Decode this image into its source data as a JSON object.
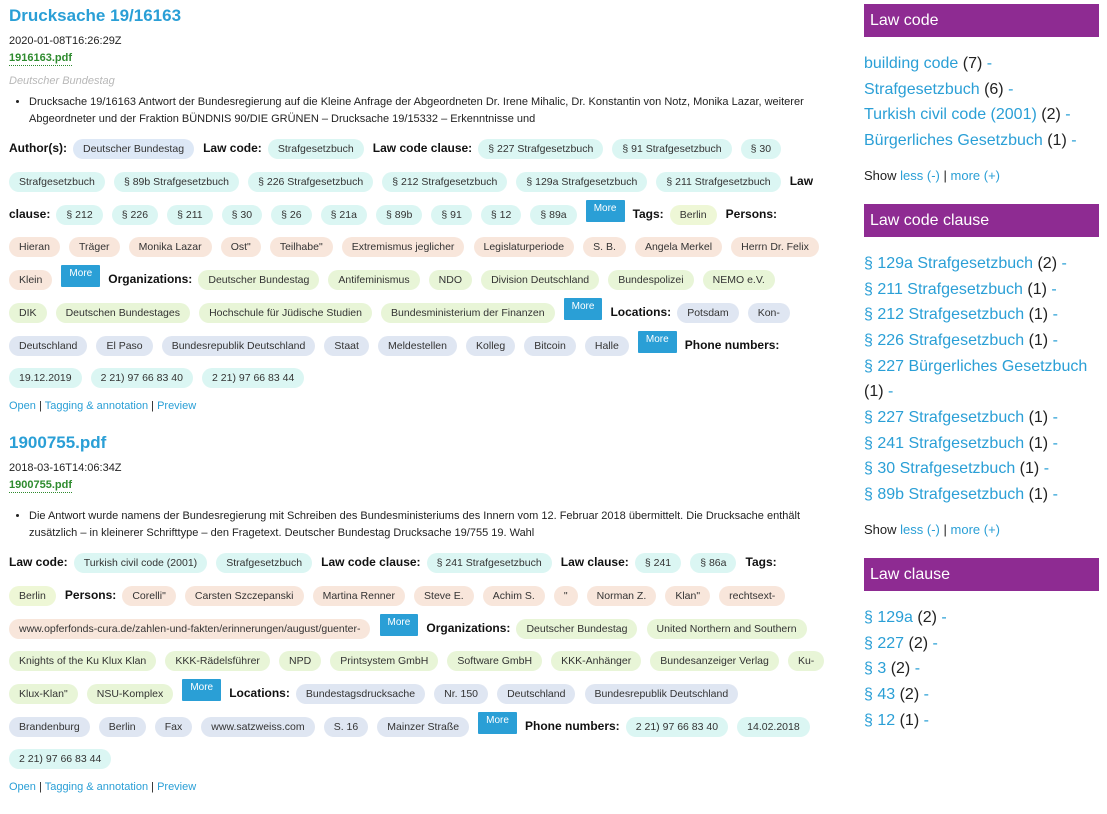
{
  "results": [
    {
      "title": "Drucksache 19/16163",
      "date": "2020-01-08T16:26:29Z",
      "file": "1916163.pdf",
      "source": "Deutscher Bundestag",
      "snippet": "Drucksache 19/16163 Antwort der Bundesregierung auf die Kleine Anfrage der Abgeordneten Dr. Irene Mihalic, Dr. Konstantin von Notz, Monika Lazar, weiterer Abgeordneter und der Fraktion BÜNDNIS 90/DIE GRÜNEN – Drucksache 19/15332 – Erkenntnisse und",
      "facets": [
        {
          "label": "Author(s):",
          "type": "author",
          "values": [
            "Deutscher Bundestag"
          ],
          "more": false
        },
        {
          "label": "Law code:",
          "type": "lc",
          "values": [
            "Strafgesetzbuch"
          ],
          "more": false
        },
        {
          "label": "Law code clause:",
          "type": "lcc",
          "values": [
            "§ 227 Strafgesetzbuch",
            "§ 91 Strafgesetzbuch",
            "§ 30 Strafgesetzbuch",
            "§ 89b Strafgesetzbuch",
            "§ 226 Strafgesetzbuch",
            "§ 212 Strafgesetzbuch",
            "§ 129a Strafgesetzbuch",
            "§ 211 Strafgesetzbuch"
          ],
          "more": false
        },
        {
          "label": "Law clause:",
          "type": "cl",
          "values": [
            "§ 212",
            "§ 226",
            "§ 211",
            "§ 30",
            "§ 26",
            "§ 21a",
            "§ 89b",
            "§ 91",
            "§ 12",
            "§ 89a"
          ],
          "more": true
        },
        {
          "label": "Tags:",
          "type": "tag",
          "values": [
            "Berlin"
          ],
          "more": false
        },
        {
          "label": "Persons:",
          "type": "person",
          "values": [
            "Hieran",
            "Träger",
            "Monika Lazar",
            "Ost\"",
            "Teilhabe\"",
            "Extremismus jeglicher",
            "Legislaturperiode",
            "S. B.",
            "Angela Merkel",
            "Herrn Dr. Felix Klein"
          ],
          "more": true
        },
        {
          "label": "Organizations:",
          "type": "org",
          "values": [
            "Deutscher Bundestag",
            "Antifeminismus",
            "NDO",
            "Division Deutschland",
            "Bundespolizei",
            "NEMO e.V.",
            "DIK",
            "Deutschen Bundestages",
            "Hochschule für Jüdische Studien",
            "Bundesministerium der Finanzen"
          ],
          "more": true
        },
        {
          "label": "Locations:",
          "type": "loc",
          "values": [
            "Potsdam",
            "Kon-",
            "Deutschland",
            "El Paso",
            "Bundesrepublik Deutschland",
            "Staat",
            "Meldestellen",
            "Kolleg",
            "Bitcoin",
            "Halle"
          ],
          "more": true
        },
        {
          "label": "Phone numbers:",
          "type": "phone",
          "values": [
            "19.12.2019",
            "2 21) 97 66 83 40",
            "2 21) 97 66 83 44"
          ],
          "more": false
        }
      ]
    },
    {
      "title": "1900755.pdf",
      "date": "2018-03-16T14:06:34Z",
      "file": "1900755.pdf",
      "source": "",
      "snippet": "Die Antwort wurde namens der Bundesregierung mit Schreiben des Bundesministeriums des Innern vom 12. Februar 2018 übermittelt. Die Drucksache enthält zusätzlich – in kleinerer Schrifttype – den Fragetext. Deutscher Bundestag Drucksache 19/755 19. Wahl",
      "facets": [
        {
          "label": "Law code:",
          "type": "lc",
          "values": [
            "Turkish civil code (2001)",
            "Strafgesetzbuch"
          ],
          "more": false
        },
        {
          "label": "Law code clause:",
          "type": "lcc",
          "values": [
            "§ 241 Strafgesetzbuch"
          ],
          "more": false
        },
        {
          "label": "Law clause:",
          "type": "cl",
          "values": [
            "§ 241",
            "§ 86a"
          ],
          "more": false
        },
        {
          "label": "Tags:",
          "type": "tag",
          "values": [
            "Berlin"
          ],
          "more": false
        },
        {
          "label": "Persons:",
          "type": "person",
          "values": [
            "Corelli\"",
            "Carsten Szczepanski",
            "Martina Renner",
            "Steve E.",
            "Achim S.",
            "\"",
            "Norman Z.",
            "Klan\"",
            "rechtsext-",
            "www.opferfonds-cura.de/zahlen-und-fakten/erinnerungen/august/guenter-"
          ],
          "more": true
        },
        {
          "label": "Organizations:",
          "type": "org",
          "values": [
            "Deutscher Bundestag",
            "United Northern and Southern Knights of the Ku Klux Klan",
            "KKK-Rädelsführer",
            "NPD",
            "Printsystem GmbH",
            "Software GmbH",
            "KKK-Anhänger",
            "Bundesanzeiger Verlag",
            "Ku-Klux-Klan\"",
            "NSU-Komplex"
          ],
          "more": true
        },
        {
          "label": "Locations:",
          "type": "loc",
          "values": [
            "Bundestagsdrucksache",
            "Nr. 150",
            "Deutschland",
            "Bundesrepublik Deutschland",
            "Brandenburg",
            "Berlin",
            "Fax",
            "www.satzweiss.com",
            "S. 16",
            "Mainzer Straße"
          ],
          "more": true
        },
        {
          "label": "Phone numbers:",
          "type": "phone",
          "values": [
            "2 21) 97 66 83 40",
            "14.02.2018",
            "2 21) 97 66 83 44"
          ],
          "more": false
        }
      ]
    }
  ],
  "more_label": "More",
  "actions": {
    "open": "Open",
    "sep": "|",
    "tagging": "Tagging & annotation",
    "preview": "Preview"
  },
  "sidebar": {
    "panels": [
      {
        "title": "Law code",
        "items": [
          {
            "label": "building code",
            "count": "(7)"
          },
          {
            "label": "Strafgesetzbuch",
            "count": "(6)"
          },
          {
            "label": "Turkish civil code (2001)",
            "count": "(2)"
          },
          {
            "label": "Bürgerliches Gesetzbuch",
            "count": "(1)"
          }
        ],
        "show": true
      },
      {
        "title": "Law code clause",
        "items": [
          {
            "label": "§ 129a Strafgesetzbuch",
            "count": "(2)"
          },
          {
            "label": "§ 211 Strafgesetzbuch",
            "count": "(1)"
          },
          {
            "label": "§ 212 Strafgesetzbuch",
            "count": "(1)"
          },
          {
            "label": "§ 226 Strafgesetzbuch",
            "count": "(1)"
          },
          {
            "label": "§ 227 Bürgerliches Gesetzbuch",
            "count": "(1)"
          },
          {
            "label": "§ 227 Strafgesetzbuch",
            "count": "(1)"
          },
          {
            "label": "§ 241 Strafgesetzbuch",
            "count": "(1)"
          },
          {
            "label": "§ 30 Strafgesetzbuch",
            "count": "(1)"
          },
          {
            "label": "§ 89b Strafgesetzbuch",
            "count": "(1)"
          }
        ],
        "show": true
      },
      {
        "title": "Law clause",
        "items": [
          {
            "label": "§ 129a",
            "count": "(2)"
          },
          {
            "label": "§ 227",
            "count": "(2)"
          },
          {
            "label": "§ 3",
            "count": "(2)"
          },
          {
            "label": "§ 43",
            "count": "(2)"
          },
          {
            "label": "§ 12",
            "count": "(1)"
          }
        ],
        "show": false
      }
    ],
    "minus": "-",
    "show_label": "Show",
    "less_label": "less (-)",
    "pipe": "|",
    "more_label": "more (+)"
  }
}
